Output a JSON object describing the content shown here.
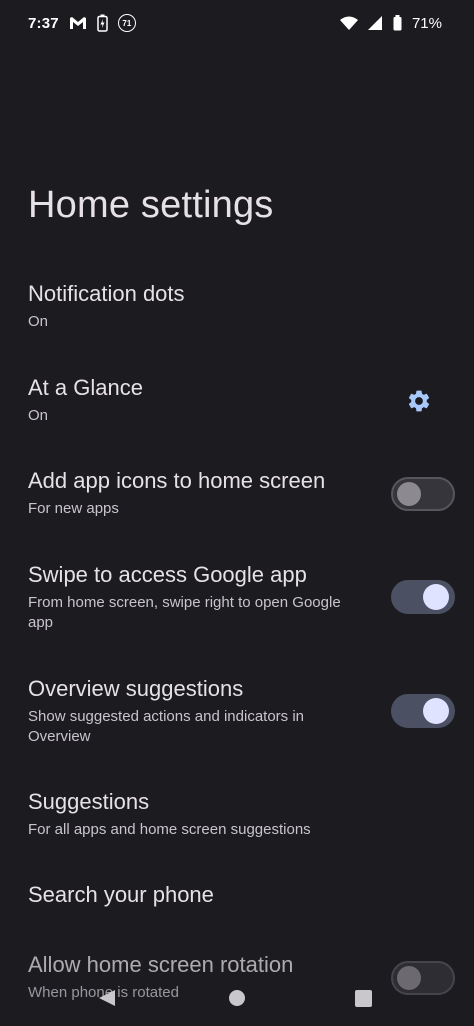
{
  "status_bar": {
    "time": "7:37",
    "notification_badge": "71",
    "battery": "71%"
  },
  "page": {
    "title": "Home settings"
  },
  "settings": [
    {
      "title": "Notification dots",
      "summary": "On"
    },
    {
      "title": "At a Glance",
      "summary": "On",
      "action": "gear-icon"
    },
    {
      "title": "Add app icons to home screen",
      "summary": "For new apps",
      "toggle": false
    },
    {
      "title": "Swipe to access Google app",
      "summary": "From home screen, swipe right to open Google app",
      "toggle": true
    },
    {
      "title": "Overview suggestions",
      "summary": "Show suggested actions and indicators in Overview",
      "toggle": true
    },
    {
      "title": "Suggestions",
      "summary": "For all apps and home screen suggestions"
    },
    {
      "title": "Search your phone"
    },
    {
      "title": "Allow home screen rotation",
      "summary": "When phone is rotated",
      "toggle": false
    }
  ],
  "icons": {
    "status": [
      "gmail-icon",
      "battery-saver-icon",
      "wifi-icon",
      "signal-icon",
      "battery-icon"
    ],
    "navigation": [
      "back-icon",
      "home-icon",
      "recents-icon"
    ]
  },
  "colors": {
    "background": "#1c1b20",
    "text_primary": "#e6e1e5",
    "text_secondary": "#c9c4cc",
    "switch_on_track": "#4b5063",
    "switch_on_knob": "#e0e3ff",
    "switch_off_knob": "#8c8990"
  }
}
